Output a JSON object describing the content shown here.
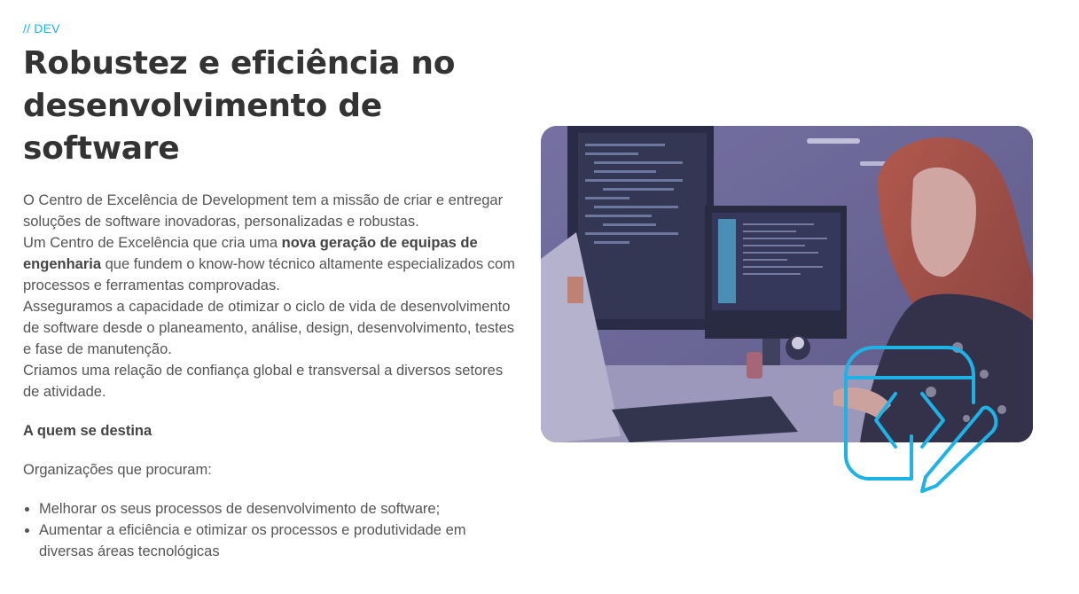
{
  "section": {
    "eyebrow": "// DEV",
    "title": "Robustez e eficiência no desenvolvimento de software"
  },
  "description": {
    "p1": "O Centro de Excelência de Development tem a missão de criar e entregar soluções de software inovadoras, personalizadas e robustas.",
    "p2_before": "Um Centro de Excelência que cria uma ",
    "p2_bold": "nova geração de equipas de engenharia",
    "p2_after": " que fundem o know-how técnico altamente especializados com processos e ferramentas comprovadas.",
    "p3": "Asseguramos a capacidade de otimizar o ciclo de vida de desenvolvimento de software desde o planeamento, análise, design, desenvolvimento, testes e fase de manutenção.",
    "p4": "Criamos uma relação de confiança global e transversal a diversos setores de atividade."
  },
  "audience": {
    "heading": "A quem se destina",
    "intro": "Organizações que procuram:",
    "items": [
      "Melhorar os seus processos de desenvolvimento de software;",
      "Aumentar a eficiência e otimizar os processos e produtividade em diversas áreas tecnológicas"
    ]
  },
  "media": {
    "photo_icon": "developer-at-monitors-photo",
    "badge_icon": "code-window-pencil-icon",
    "accent_color": "#1fb3e5",
    "overlay_color": "#6c6795"
  }
}
